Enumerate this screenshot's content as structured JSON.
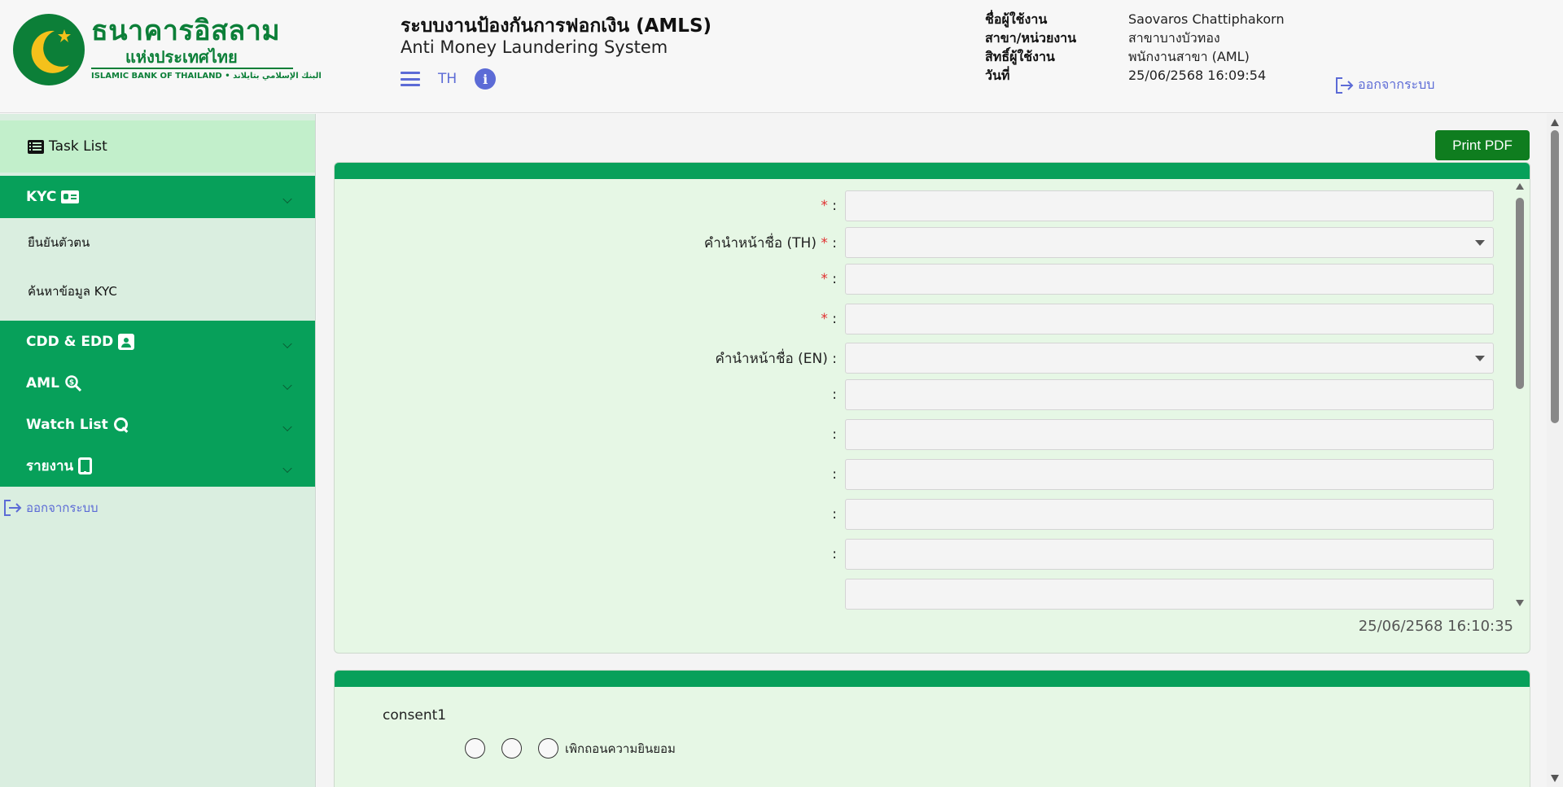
{
  "header": {
    "logo": {
      "name_th": "ธนาคารอิสลาม",
      "name_th_line2": "แห่งประเทศไทย",
      "name_en": "ISLAMIC BANK OF THAILAND",
      "name_ar": "البنك الإسلامي بتايلاند",
      "icon": "crescent-logo",
      "color": "#0c7f38"
    },
    "system_title": "ระบบงานป้องกันการฟอกเงิน (AMLS)",
    "system_subtitle": "Anti Money Laundering System",
    "language": "TH",
    "icons": [
      "hamburger-menu-icon",
      "info-icon"
    ],
    "user": {
      "name_label": "ชื่อผู้ใช้งาน",
      "name": "Saovaros Chattiphakorn",
      "branch_label": "สาขา/หน่วยงาน",
      "branch": "สาขาบางบัวทอง",
      "role_label": "สิทธิ์ผู้ใช้งาน",
      "role": "พนักงานสาขา (AML)",
      "date_label": "วันที่",
      "date": "25/06/2568 16:09:54"
    },
    "logout_label": "ออกจากระบบ"
  },
  "sidebar": {
    "task_list": "Task List",
    "groups": [
      {
        "label": "KYC",
        "icon": "id-card-icon",
        "items": [
          "ยืนยันตัวตน",
          "ค้นหาข้อมูล KYC"
        ]
      },
      {
        "label": "CDD & EDD",
        "icon": "id-badge-icon"
      },
      {
        "label": "AML",
        "icon": "search-dollar-icon"
      },
      {
        "label": "Watch List",
        "icon": "search-icon"
      },
      {
        "label": "รายงาน",
        "icon": "tablet-icon"
      }
    ],
    "logout_label": "ออกจากระบบ"
  },
  "main": {
    "print_button": "Print PDF",
    "form": {
      "fields": [
        {
          "label": "",
          "required": true,
          "type": "text",
          "value": ""
        },
        {
          "label": "คำนำหน้าชื่อ (TH)",
          "required": true,
          "type": "select",
          "value": ""
        },
        {
          "label": "",
          "required": true,
          "type": "text",
          "value": ""
        },
        {
          "label": "",
          "required": true,
          "type": "text",
          "value": ""
        },
        {
          "label": "คำนำหน้าชื่อ (EN)",
          "required": false,
          "type": "select",
          "value": ""
        },
        {
          "label": "",
          "required": false,
          "type": "text",
          "value": ""
        },
        {
          "label": "",
          "required": false,
          "type": "text",
          "value": ""
        },
        {
          "label": "",
          "required": false,
          "type": "text",
          "value": ""
        },
        {
          "label": "",
          "required": false,
          "type": "text",
          "value": ""
        },
        {
          "label": "",
          "required": false,
          "type": "text",
          "value": ""
        }
      ],
      "timestamp": "25/06/2568 16:10:35"
    },
    "consent": {
      "title": "consent1",
      "options": [
        "",
        "",
        "เพิกถอนความยินยอม"
      ]
    }
  },
  "colors": {
    "nav_green": "#07a05a",
    "card_bg": "#e6f7e5",
    "print_button": "#0f7d1f",
    "link_blue": "#5c6bd6",
    "required": "#e03030"
  }
}
